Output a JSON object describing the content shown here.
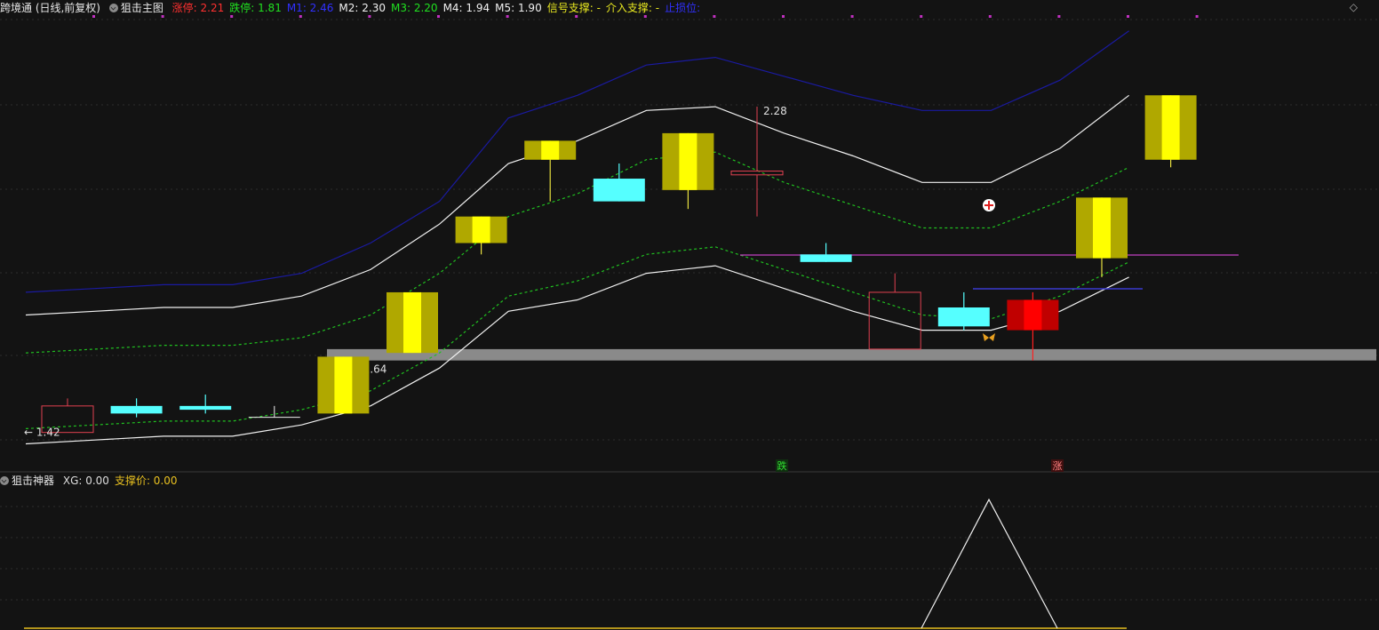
{
  "main_header": {
    "stock_name": "跨境通 (日线,前复权)",
    "indicator_name": "狙击主图",
    "items": [
      {
        "label": "涨停:",
        "value": "2.21",
        "color": "#ff3030"
      },
      {
        "label": "跌停:",
        "value": "1.81",
        "color": "#20e020"
      },
      {
        "label": "M1:",
        "value": "2.46",
        "color": "#3030ff"
      },
      {
        "label": "M2:",
        "value": "2.30",
        "color": "#f0f0f0"
      },
      {
        "label": "M3:",
        "value": "2.20",
        "color": "#20e020"
      },
      {
        "label": "M4:",
        "value": "1.94",
        "color": "#f0f0f0"
      },
      {
        "label": "M5:",
        "value": "1.90",
        "color": "#f0f0f0"
      },
      {
        "label": "信号支撑:",
        "value": "-",
        "color": "#e8e820"
      },
      {
        "label": "介入支撑:",
        "value": "-",
        "color": "#e8e820"
      },
      {
        "label": "止损位:",
        "value": "",
        "color": "#3030ff"
      }
    ]
  },
  "indicator_header": {
    "name": "狙击神器",
    "items": [
      {
        "label": "XG:",
        "value": "0.00",
        "color": "#dddddd"
      },
      {
        "label": "支撑价:",
        "value": "0.00",
        "color": "#e8c020"
      }
    ]
  },
  "labels": {
    "high_marker": "2.28",
    "low_marker": "← 1.42",
    "zone_label": "1.61 - 1.64",
    "signal_fall": "跌",
    "signal_rise": "涨"
  },
  "colors": {
    "background": "#131313",
    "bull_body": "#b0a800",
    "bull_center": "#ffff00",
    "bear_body": "#55ffff",
    "hollow": "#e04050",
    "limit_up": "#ff0000",
    "band_blue": "#1a1aa0",
    "band_white": "#f0f0f0",
    "band_green": "#20c020",
    "support_gray": "#8a8a8a",
    "magenta_line": "#c040c0"
  },
  "chart_data": {
    "type": "candlestick",
    "dates": [
      1,
      2,
      3,
      4,
      5,
      6,
      7,
      8,
      9,
      10,
      11,
      12,
      13,
      14,
      15,
      16,
      17
    ],
    "candles": [
      {
        "open": 1.49,
        "close": 1.42,
        "high": 1.51,
        "low": 1.42,
        "style": "hollow"
      },
      {
        "open": 1.49,
        "close": 1.47,
        "high": 1.51,
        "low": 1.46,
        "style": "bear"
      },
      {
        "open": 1.49,
        "close": 1.48,
        "high": 1.52,
        "low": 1.47,
        "style": "bear"
      },
      {
        "open": 1.46,
        "close": 1.46,
        "high": 1.49,
        "low": 1.46,
        "style": "doji"
      },
      {
        "open": 1.47,
        "close": 1.62,
        "high": 1.62,
        "low": 1.47,
        "style": "bull"
      },
      {
        "open": 1.63,
        "close": 1.79,
        "high": 1.79,
        "low": 1.63,
        "style": "bull"
      },
      {
        "open": 1.92,
        "close": 1.99,
        "high": 1.99,
        "low": 1.89,
        "style": "bull"
      },
      {
        "open": 2.14,
        "close": 2.19,
        "high": 2.19,
        "low": 2.03,
        "style": "bull"
      },
      {
        "open": 2.09,
        "close": 2.03,
        "high": 2.13,
        "low": 2.03,
        "style": "bear"
      },
      {
        "open": 2.06,
        "close": 2.21,
        "high": 2.21,
        "low": 2.01,
        "style": "bull"
      },
      {
        "open": 2.1,
        "close": 2.11,
        "high": 2.28,
        "low": 1.99,
        "style": "hollow"
      },
      {
        "open": 1.89,
        "close": 1.87,
        "high": 1.92,
        "low": 1.87,
        "style": "bear"
      },
      {
        "open": 1.64,
        "close": 1.79,
        "high": 1.84,
        "low": 1.64,
        "style": "hollow"
      },
      {
        "open": 1.75,
        "close": 1.7,
        "high": 1.79,
        "low": 1.69,
        "style": "bear"
      },
      {
        "open": 1.69,
        "close": 1.77,
        "high": 1.79,
        "low": 1.61,
        "style": "limitup"
      },
      {
        "open": 1.88,
        "close": 2.04,
        "high": 2.04,
        "low": 1.83,
        "style": "bull"
      },
      {
        "open": 2.14,
        "close": 2.31,
        "high": 2.31,
        "low": 2.12,
        "style": "bull"
      }
    ],
    "band_x": [
      1,
      2,
      3,
      4,
      5,
      6,
      7,
      8,
      9,
      10,
      11,
      12,
      13,
      14,
      15,
      16,
      17
    ],
    "bands": [
      {
        "name": "M1",
        "color": "#1a1aa0",
        "dash": false,
        "values": [
          1.79,
          1.8,
          1.81,
          1.81,
          1.84,
          1.92,
          2.03,
          2.25,
          2.31,
          2.39,
          2.41,
          2.36,
          2.31,
          2.27,
          2.27,
          2.35,
          2.48
        ]
      },
      {
        "name": "M2",
        "color": "#f0f0f0",
        "dash": false,
        "values": [
          1.73,
          1.74,
          1.75,
          1.75,
          1.78,
          1.85,
          1.97,
          2.13,
          2.19,
          2.27,
          2.28,
          2.21,
          2.15,
          2.08,
          2.08,
          2.17,
          2.31
        ]
      },
      {
        "name": "M3",
        "color": "#20c020",
        "dash": true,
        "values": [
          1.63,
          1.64,
          1.65,
          1.65,
          1.67,
          1.73,
          1.84,
          1.99,
          2.05,
          2.14,
          2.16,
          2.08,
          2.02,
          1.96,
          1.96,
          2.03,
          2.12
        ]
      },
      {
        "name": "M4",
        "color": "#20c020",
        "dash": true,
        "values": [
          1.43,
          1.44,
          1.45,
          1.45,
          1.48,
          1.53,
          1.63,
          1.78,
          1.82,
          1.89,
          1.91,
          1.85,
          1.79,
          1.73,
          1.72,
          1.78,
          1.87
        ]
      },
      {
        "name": "M5",
        "color": "#f0f0f0",
        "dash": false,
        "values": [
          1.39,
          1.4,
          1.41,
          1.41,
          1.44,
          1.49,
          1.59,
          1.74,
          1.77,
          1.84,
          1.86,
          1.8,
          1.74,
          1.69,
          1.69,
          1.74,
          1.83
        ]
      }
    ],
    "support_zone": [
      1.61,
      1.64
    ],
    "ylim": [
      1.37,
      2.51
    ],
    "indicator": {
      "type": "line",
      "x": [
        14,
        15,
        16
      ],
      "values": [
        0,
        1,
        0
      ],
      "ylim": [
        0,
        1.05
      ],
      "baseline_color": "#e8c020"
    }
  }
}
